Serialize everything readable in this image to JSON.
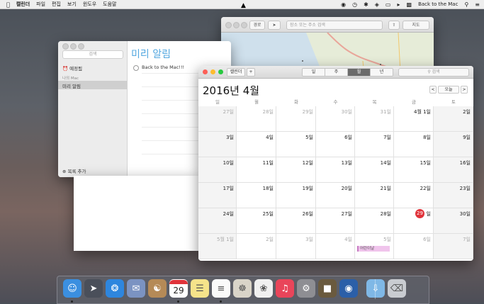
{
  "menubar": {
    "items": [
      "캘린더",
      "파일",
      "편집",
      "보기",
      "윈도우",
      "도움말"
    ],
    "right_text": "Back to the Mac"
  },
  "maps": {
    "back_label": "경로",
    "search_placeholder": "장소 또는 주소 검색",
    "mode_label": "지도"
  },
  "reminders": {
    "search_placeholder": "검색",
    "sidebar_items": [
      "예정됨",
      "나의 Mac",
      "미리 알림"
    ],
    "add_list_label": "목록 추가",
    "title": "미리 알림",
    "items": [
      "Back to the Mac!!!"
    ]
  },
  "calendar": {
    "calendars_btn": "캘린더",
    "add_btn": "+",
    "views": [
      "일",
      "주",
      "월",
      "년"
    ],
    "active_view": "월",
    "search_placeholder": "검색",
    "month_title": "2016년 4월",
    "nav": {
      "prev": "<",
      "today": "오늘",
      "next": ">"
    },
    "weekdays": [
      "일",
      "월",
      "화",
      "수",
      "목",
      "금",
      "토"
    ],
    "weeks": [
      [
        {
          "d": "27일",
          "dim": true
        },
        {
          "d": "28일",
          "dim": true
        },
        {
          "d": "29일",
          "dim": true
        },
        {
          "d": "30일",
          "dim": true
        },
        {
          "d": "31일",
          "dim": true
        },
        {
          "d": "4월 1일"
        },
        {
          "d": "2일"
        }
      ],
      [
        {
          "d": "3일"
        },
        {
          "d": "4일"
        },
        {
          "d": "5일"
        },
        {
          "d": "6일"
        },
        {
          "d": "7일"
        },
        {
          "d": "8일"
        },
        {
          "d": "9일"
        }
      ],
      [
        {
          "d": "10일"
        },
        {
          "d": "11일"
        },
        {
          "d": "12일"
        },
        {
          "d": "13일"
        },
        {
          "d": "14일"
        },
        {
          "d": "15일"
        },
        {
          "d": "16일"
        }
      ],
      [
        {
          "d": "17일"
        },
        {
          "d": "18일"
        },
        {
          "d": "19일"
        },
        {
          "d": "20일"
        },
        {
          "d": "21일"
        },
        {
          "d": "22일"
        },
        {
          "d": "23일"
        }
      ],
      [
        {
          "d": "24일"
        },
        {
          "d": "25일"
        },
        {
          "d": "26일"
        },
        {
          "d": "27일"
        },
        {
          "d": "28일"
        },
        {
          "d": "29",
          "today": true,
          "suffix": "일"
        },
        {
          "d": "30일"
        }
      ],
      [
        {
          "d": "5월 1일",
          "dim": true
        },
        {
          "d": "2일",
          "dim": true
        },
        {
          "d": "3일",
          "dim": true
        },
        {
          "d": "4일",
          "dim": true
        },
        {
          "d": "5일",
          "dim": true,
          "event": "어린이날"
        },
        {
          "d": "6일",
          "dim": true
        },
        {
          "d": "7일",
          "dim": true
        }
      ]
    ]
  },
  "dock": {
    "calendar_icon_day": "29",
    "apps": [
      "finder-icon",
      "launchpad-icon",
      "safari-icon",
      "mail-icon",
      "contacts-icon",
      "calendar-icon",
      "notes-icon",
      "reminders-icon",
      "preview-icon",
      "photos-icon",
      "itunes-icon",
      "system-preferences-icon",
      "quicktime-icon",
      "screenshot-icon",
      "downloads-icon",
      "trash-icon"
    ]
  }
}
